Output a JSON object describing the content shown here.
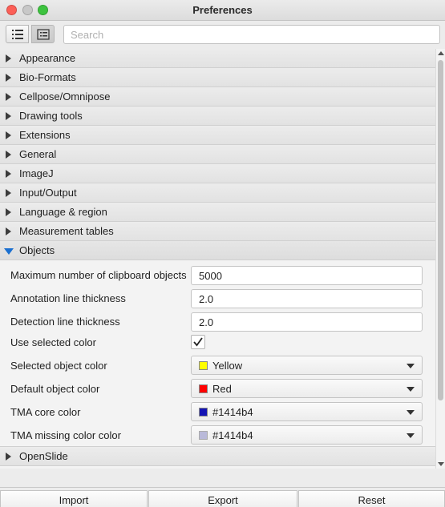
{
  "window": {
    "title": "Preferences"
  },
  "toolbar": {
    "search_placeholder": "Search"
  },
  "sections_before": [
    {
      "label": "Appearance"
    },
    {
      "label": "Bio-Formats"
    },
    {
      "label": "Cellpose/Omnipose"
    },
    {
      "label": "Drawing tools"
    },
    {
      "label": "Extensions"
    },
    {
      "label": "General"
    },
    {
      "label": "ImageJ"
    },
    {
      "label": "Input/Output"
    },
    {
      "label": "Language & region"
    },
    {
      "label": "Measurement tables"
    }
  ],
  "objects": {
    "label": "Objects",
    "expanded": true,
    "max_clipboard": {
      "label": "Maximum number of clipboard objects",
      "value": "5000"
    },
    "annotation_thickness": {
      "label": "Annotation line thickness",
      "value": "2.0"
    },
    "detection_thickness": {
      "label": "Detection line thickness",
      "value": "2.0"
    },
    "use_selected_color": {
      "label": "Use selected color",
      "checked": true
    },
    "selected_color": {
      "label": "Selected object color",
      "value": "Yellow",
      "swatch": "#ffff00"
    },
    "default_color": {
      "label": "Default object color",
      "value": "Red",
      "swatch": "#ff0000"
    },
    "tma_core_color": {
      "label": "TMA core color",
      "value": "#1414b4",
      "swatch": "#1414b4"
    },
    "tma_missing_color": {
      "label": "TMA missing color color",
      "value": "#1414b4",
      "swatch": "#b9b9d9"
    }
  },
  "sections_after": [
    {
      "label": "OpenSlide"
    }
  ],
  "buttons": {
    "import": "Import",
    "export": "Export",
    "reset": "Reset"
  }
}
